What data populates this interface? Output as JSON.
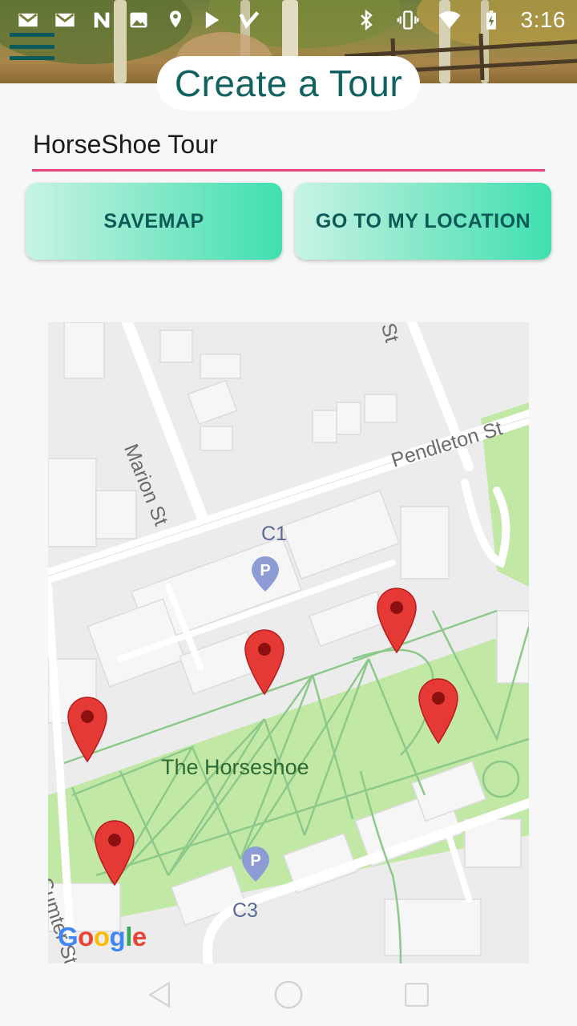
{
  "status_bar": {
    "time": "3:16",
    "left_icons": [
      "gmail-icon",
      "gmail-icon",
      "n-app-icon",
      "image-icon",
      "maps-icon",
      "play-store-icon",
      "check-app-icon"
    ],
    "right_icons": [
      "bluetooth-icon",
      "vibrate-icon",
      "wifi-icon",
      "battery-charging-icon"
    ]
  },
  "header": {
    "title": "Create a Tour",
    "menu_icon": "hamburger-menu-icon"
  },
  "form": {
    "tour_name_value": "HorseShoe Tour",
    "save_button_label": "SAVEMAP",
    "location_button_label": "GO TO MY LOCATION"
  },
  "map": {
    "street_labels": {
      "marion": "Marion St",
      "pendleton": "Pendleton St",
      "sumter": "Sumter St",
      "top_partial": "St"
    },
    "park_label": "The Horseshoe",
    "parking_lots": [
      "C1",
      "C3"
    ],
    "parking_symbol": "P",
    "logo_letters": [
      "G",
      "o",
      "o",
      "g",
      "l",
      "e"
    ],
    "logo_colors": [
      "#4285F4",
      "#EA4335",
      "#FBBC05",
      "#4285F4",
      "#34A853",
      "#EA4335"
    ],
    "marker_count": 5,
    "marker_color": "#e53935",
    "park_color": "#c2e8a6"
  },
  "nav_bar": {
    "buttons": [
      "back-icon",
      "home-icon",
      "recents-icon"
    ]
  }
}
